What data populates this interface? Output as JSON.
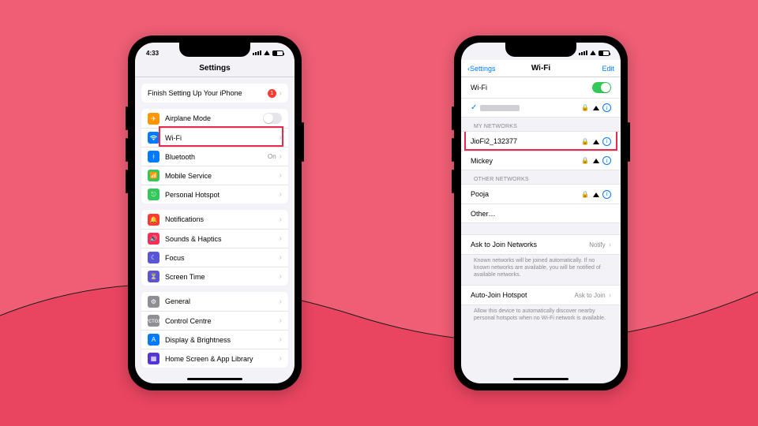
{
  "left_phone": {
    "status": {
      "time": "4:33"
    },
    "title": "Settings",
    "finish_row": {
      "label": "Finish Setting Up Your iPhone",
      "badge": "1"
    },
    "group1": [
      {
        "icon_bg": "#ff9500",
        "name": "airplane",
        "label": "Airplane Mode",
        "tail_type": "switch"
      },
      {
        "icon_bg": "#007aff",
        "name": "wifi",
        "label": "Wi-Fi",
        "tail_type": "chev"
      },
      {
        "icon_bg": "#007aff",
        "name": "bluetooth",
        "label": "Bluetooth",
        "tail_type": "detail_chev",
        "detail": "On"
      },
      {
        "icon_bg": "#34c759",
        "name": "mobile",
        "label": "Mobile Service",
        "tail_type": "chev"
      },
      {
        "icon_bg": "#34c759",
        "name": "hotspot",
        "label": "Personal Hotspot",
        "tail_type": "chev"
      }
    ],
    "group2": [
      {
        "icon_bg": "#ff3b30",
        "name": "notifications",
        "label": "Notifications"
      },
      {
        "icon_bg": "#ff2d55",
        "name": "sounds",
        "label": "Sounds & Haptics"
      },
      {
        "icon_bg": "#5856d6",
        "name": "focus",
        "label": "Focus"
      },
      {
        "icon_bg": "#5856d6",
        "name": "screentime",
        "label": "Screen Time"
      }
    ],
    "group3": [
      {
        "icon_bg": "#8e8e93",
        "name": "general",
        "label": "General"
      },
      {
        "icon_bg": "#8e8e93",
        "name": "controlcentre",
        "label": "Control Centre"
      },
      {
        "icon_bg": "#007aff",
        "name": "display",
        "label": "Display & Brightness"
      },
      {
        "icon_bg": "#5334d4",
        "name": "homescreen",
        "label": "Home Screen & App Library"
      }
    ]
  },
  "right_phone": {
    "nav": {
      "back": "Settings",
      "title": "Wi-Fi",
      "edit": "Edit"
    },
    "wifi_toggle_label": "Wi-Fi",
    "sections": {
      "my_networks": {
        "header": "MY NETWORKS",
        "items": [
          {
            "name": "JioFi2_132377"
          },
          {
            "name": "Mickey"
          }
        ]
      },
      "other_networks": {
        "header": "OTHER NETWORKS",
        "items": [
          {
            "name": "Pooja"
          },
          {
            "name": "Other…"
          }
        ]
      }
    },
    "ask_join": {
      "label": "Ask to Join Networks",
      "detail": "Notify"
    },
    "ask_join_footer": "Known networks will be joined automatically. If no known networks are available, you will be notified of available networks.",
    "auto_hotspot": {
      "label": "Auto-Join Hotspot",
      "detail": "Ask to Join"
    },
    "auto_hotspot_footer": "Allow this device to automatically discover nearby personal hotspots when no Wi-Fi network is available."
  }
}
